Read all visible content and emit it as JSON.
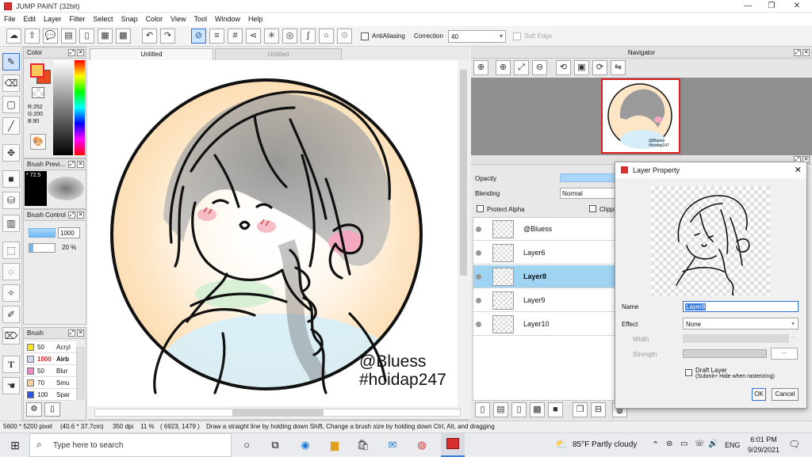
{
  "window": {
    "title": "JUMP PAINT (32bit)"
  },
  "menu": [
    "File",
    "Edit",
    "Layer",
    "Filter",
    "Select",
    "Snap",
    "Color",
    "View",
    "Tool",
    "Window",
    "Help"
  ],
  "toolbar": {
    "antialiasing": "AntiAliasing",
    "correction_label": "Correction",
    "correction_value": "40",
    "soft_edge": "Soft Edge"
  },
  "color_panel": {
    "title": "Color",
    "r": "R:252",
    "g": "G:200",
    "b": "B:90",
    "primary": "#fcc85a",
    "secondary": "#e84a20"
  },
  "brush_preview": {
    "title": "Brush Previ...",
    "size": "72.5"
  },
  "brush_control": {
    "title": "Brush Control",
    "size": "1000",
    "opacity": "20 %"
  },
  "brush_list": {
    "title": "Brush",
    "items": [
      {
        "size": "50",
        "name": "Acryl",
        "color": "#f4e81a"
      },
      {
        "size": "1000",
        "name": "Airb",
        "color": "#cfd8ee",
        "selected": true
      },
      {
        "size": "50",
        "name": "Blur",
        "color": "#f28ac8"
      },
      {
        "size": "70",
        "name": "Smu",
        "color": "#f3cf9a"
      },
      {
        "size": "100",
        "name": "Spar",
        "color": "#2a58e8"
      }
    ]
  },
  "canvas_tabs": [
    "Untitled",
    "Untitled"
  ],
  "artwork": {
    "line1": "@Bluess",
    "line2": "#hoidap247"
  },
  "navigator": {
    "title": "Navigator"
  },
  "layer_panel": {
    "opacity": "Opacity",
    "blending": "Blending",
    "blending_value": "Normal",
    "protect_alpha": "Protect Alpha",
    "clipping": "Clippi",
    "layers": [
      {
        "name": "@Bluess",
        "selected": false
      },
      {
        "name": "Layer6",
        "selected": false
      },
      {
        "name": "Layer8",
        "selected": true
      },
      {
        "name": "Layer9",
        "selected": false
      },
      {
        "name": "Layer10",
        "selected": false
      }
    ]
  },
  "dialog": {
    "title": "Layer Property",
    "name_label": "Name",
    "name_value": "Layer8",
    "effect_label": "Effect",
    "effect_value": "None",
    "width_label": "Width",
    "strength_label": "Strength",
    "strength_value": "---",
    "draft_label": "Draft Layer",
    "draft_sub": "(Submit+ Hide when rasterizing)",
    "ok": "OK",
    "cancel": "Cancel"
  },
  "status": {
    "pixels": "5600 * 5200 pixel",
    "cm": "(40.6 * 37.7cm)",
    "dpi": "350 dpi",
    "zoom": "11 %",
    "coords": "( 6923, 1479 )",
    "hint": "Draw a straight line by holding down Shift, Change a brush size by holding down Ctrl, Alt, and dragging"
  },
  "taskbar": {
    "search": "Type here to search",
    "weather": "85°F  Partly cloudy",
    "lang": "ENG",
    "time": "6:01 PM",
    "date": "9/29/2021"
  }
}
